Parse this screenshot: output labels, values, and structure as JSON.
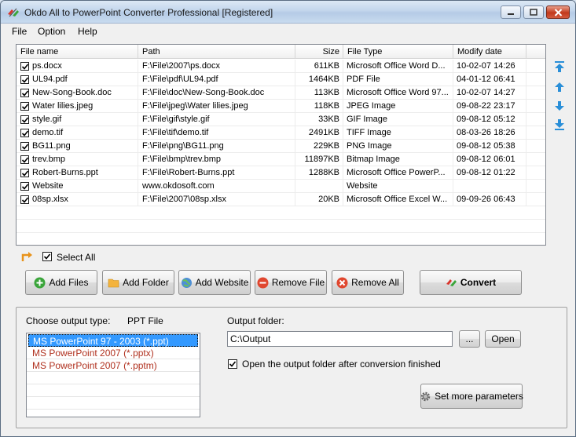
{
  "window": {
    "title": "Okdo All to PowerPoint Converter Professional [Registered]"
  },
  "menu": {
    "items": [
      {
        "label": "File"
      },
      {
        "label": "Option"
      },
      {
        "label": "Help"
      }
    ]
  },
  "table": {
    "columns": [
      {
        "label": "File name"
      },
      {
        "label": "Path"
      },
      {
        "label": "Size"
      },
      {
        "label": "File Type"
      },
      {
        "label": "Modify date"
      }
    ],
    "rows": [
      {
        "checked": true,
        "name": "ps.docx",
        "path": "F:\\File\\2007\\ps.docx",
        "size": "611KB",
        "type": "Microsoft Office Word D...",
        "date": "10-02-07 14:26"
      },
      {
        "checked": true,
        "name": "UL94.pdf",
        "path": "F:\\File\\pdf\\UL94.pdf",
        "size": "1464KB",
        "type": "PDF File",
        "date": "04-01-12 06:41"
      },
      {
        "checked": true,
        "name": "New-Song-Book.doc",
        "path": "F:\\File\\doc\\New-Song-Book.doc",
        "size": "113KB",
        "type": "Microsoft Office Word 97...",
        "date": "10-02-07 14:27"
      },
      {
        "checked": true,
        "name": "Water lilies.jpeg",
        "path": "F:\\File\\jpeg\\Water lilies.jpeg",
        "size": "118KB",
        "type": "JPEG Image",
        "date": "09-08-22 23:17"
      },
      {
        "checked": true,
        "name": "style.gif",
        "path": "F:\\File\\gif\\style.gif",
        "size": "33KB",
        "type": "GIF Image",
        "date": "09-08-12 05:12"
      },
      {
        "checked": true,
        "name": "demo.tif",
        "path": "F:\\File\\tif\\demo.tif",
        "size": "2491KB",
        "type": "TIFF Image",
        "date": "08-03-26 18:26"
      },
      {
        "checked": true,
        "name": "BG11.png",
        "path": "F:\\File\\png\\BG11.png",
        "size": "229KB",
        "type": "PNG Image",
        "date": "09-08-12 05:38"
      },
      {
        "checked": true,
        "name": "trev.bmp",
        "path": "F:\\File\\bmp\\trev.bmp",
        "size": "11897KB",
        "type": "Bitmap Image",
        "date": "09-08-12 06:01"
      },
      {
        "checked": true,
        "name": "Robert-Burns.ppt",
        "path": "F:\\File\\Robert-Burns.ppt",
        "size": "1288KB",
        "type": "Microsoft Office PowerP...",
        "date": "09-08-12 01:22"
      },
      {
        "checked": true,
        "name": "Website",
        "path": "www.okdosoft.com",
        "size": "",
        "type": "Website",
        "date": ""
      },
      {
        "checked": true,
        "name": "08sp.xlsx",
        "path": "F:\\File\\2007\\08sp.xlsx",
        "size": "20KB",
        "type": "Microsoft Office Excel W...",
        "date": "09-09-26 06:43"
      }
    ]
  },
  "select_all": {
    "label": "Select All",
    "checked": true
  },
  "buttons": {
    "add_files": "Add Files",
    "add_folder": "Add Folder",
    "add_website": "Add Website",
    "remove_file": "Remove File",
    "remove_all": "Remove All",
    "convert": "Convert"
  },
  "output": {
    "type_label": "Choose output type:",
    "type_value": "PPT File",
    "types": [
      {
        "label": "MS PowerPoint 97 - 2003 (*.ppt)",
        "selected": true
      },
      {
        "label": "MS PowerPoint 2007 (*.pptx)",
        "selected": false
      },
      {
        "label": "MS PowerPoint 2007 (*.pptm)",
        "selected": false
      }
    ],
    "folder_label": "Output folder:",
    "folder_value": "C:\\Output",
    "browse_label": "...",
    "open_label": "Open",
    "open_after_label": "Open the output folder after conversion finished",
    "open_after_checked": true,
    "more_params_label": "Set more parameters"
  },
  "colors": {
    "selection": "#3399ff",
    "list_text": "#b0301e",
    "arrow_blue": "#2a8fd8"
  }
}
